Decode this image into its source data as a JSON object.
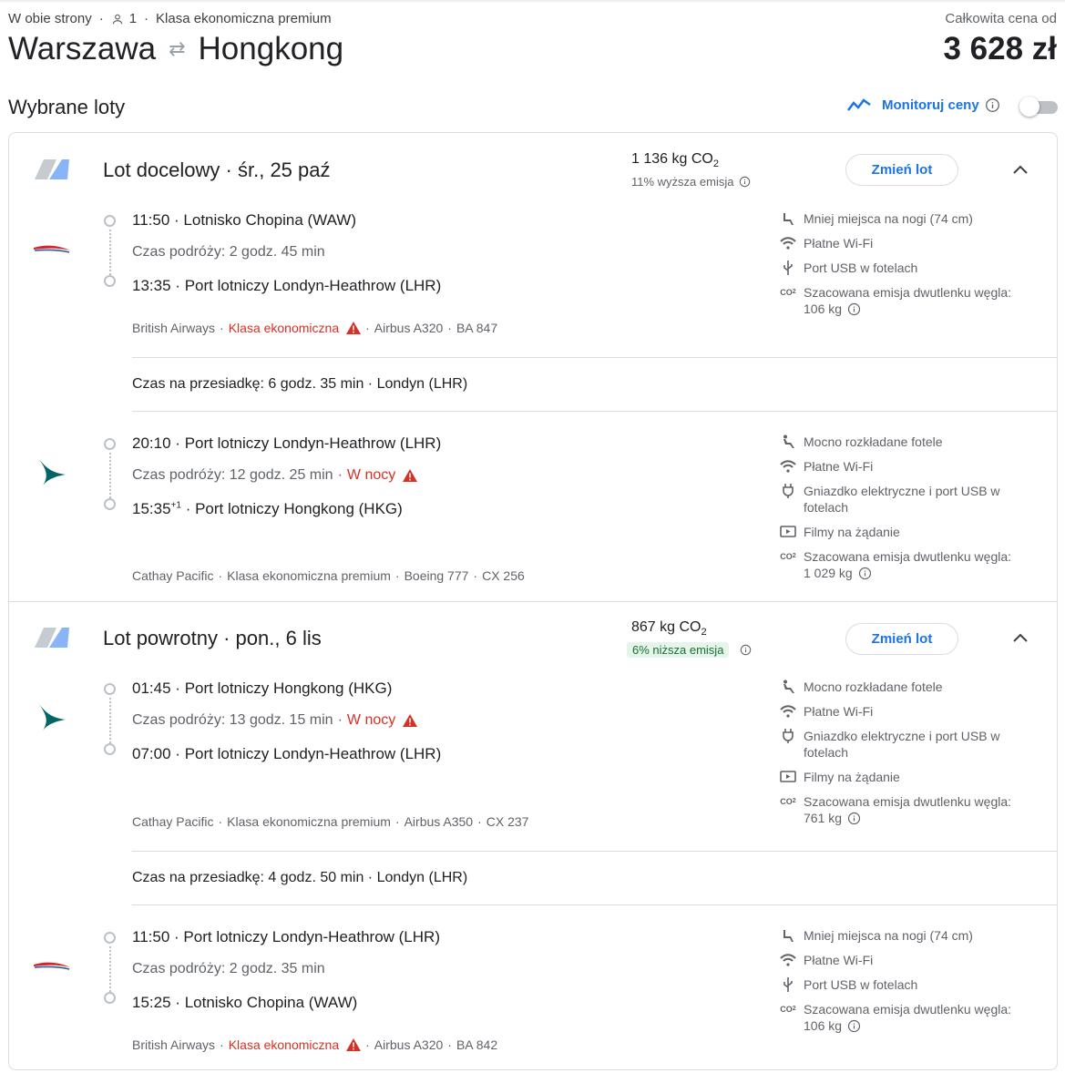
{
  "header": {
    "trip_type": "W obie strony",
    "passengers": "1",
    "cabin": "Klasa ekonomiczna premium",
    "origin": "Warszawa",
    "destination": "Hongkong",
    "price_label": "Całkowita cena od",
    "price": "3 628 zł"
  },
  "section": {
    "title": "Wybrane loty",
    "track_label": "Monitoruj ceny",
    "track_enabled": false
  },
  "outbound": {
    "title": "Lot docelowy",
    "date": "śr., 25 paź",
    "co2_value": "1 136 kg CO",
    "co2_note": "11% wyższa emisja",
    "change_button": "Zmień lot",
    "segments": [
      {
        "dep_time": "11:50",
        "dep_airport": "Lotnisko Chopina (WAW)",
        "duration": "Czas podróży: 2 godz. 45 min",
        "arr_time": "13:35",
        "arr_sup": "",
        "arr_airport": "Port lotniczy Londyn-Heathrow (LHR)",
        "airline": "British Airways",
        "cabin": "Klasa ekonomiczna",
        "aircraft": "Airbus A320",
        "flight_no": "BA 847",
        "amenities": [
          "Mniej miejsca na nogi (74 cm)",
          "Płatne Wi-Fi",
          "Port USB w fotelach"
        ],
        "co2_label": "Szacowana emisja dwutlenku węgla:",
        "co2_kg": "106 kg"
      },
      {
        "dep_time": "20:10",
        "dep_airport": "Port lotniczy Londyn-Heathrow (LHR)",
        "duration": "Czas podróży: 12 godz. 25 min",
        "night": "W nocy",
        "arr_time": "15:35",
        "arr_sup": "+1",
        "arr_airport": "Port lotniczy Hongkong (HKG)",
        "airline": "Cathay Pacific",
        "cabin": "Klasa ekonomiczna premium",
        "aircraft": "Boeing 777",
        "flight_no": "CX 256",
        "amenities": [
          "Mocno rozkładane fotele",
          "Płatne Wi-Fi",
          "Gniazdko elektryczne i port USB w fotelach",
          "Filmy na żądanie"
        ],
        "co2_label": "Szacowana emisja dwutlenku węgla:",
        "co2_kg": "1 029 kg"
      }
    ],
    "layover": "Czas na przesiadkę: 6 godz. 35 min · Londyn (LHR)"
  },
  "inbound": {
    "title": "Lot powrotny",
    "date": "pon., 6 lis",
    "co2_value": "867 kg CO",
    "co2_note": "6% niższa emisja",
    "change_button": "Zmień lot",
    "segments": [
      {
        "dep_time": "01:45",
        "dep_airport": "Port lotniczy Hongkong (HKG)",
        "duration": "Czas podróży: 13 godz. 15 min",
        "night": "W nocy",
        "arr_time": "07:00",
        "arr_airport": "Port lotniczy Londyn-Heathrow (LHR)",
        "airline": "Cathay Pacific",
        "cabin": "Klasa ekonomiczna premium",
        "aircraft": "Airbus A350",
        "flight_no": "CX 237",
        "amenities": [
          "Mocno rozkładane fotele",
          "Płatne Wi-Fi",
          "Gniazdko elektryczne i port USB w fotelach",
          "Filmy na żądanie"
        ],
        "co2_label": "Szacowana emisja dwutlenku węgla:",
        "co2_kg": "761 kg"
      },
      {
        "dep_time": "11:50",
        "dep_airport": "Port lotniczy Londyn-Heathrow (LHR)",
        "duration": "Czas podróży: 2 godz. 35 min",
        "arr_time": "15:25",
        "arr_airport": "Lotnisko Chopina (WAW)",
        "airline": "British Airways",
        "cabin": "Klasa ekonomiczna",
        "aircraft": "Airbus A320",
        "flight_no": "BA 842",
        "amenities": [
          "Mniej miejsca na nogi (74 cm)",
          "Płatne Wi-Fi",
          "Port USB w fotelach"
        ],
        "co2_label": "Szacowana emisja dwutlenku węgla:",
        "co2_kg": "106 kg"
      }
    ],
    "layover": "Czas na przesiadkę: 4 godz. 50 min · Londyn (LHR)"
  },
  "common": {
    "co2_sub": "2",
    "dot": "·"
  },
  "colors": {
    "accent": "#1a73e8",
    "warning": "#d93025",
    "green": "#137333"
  }
}
